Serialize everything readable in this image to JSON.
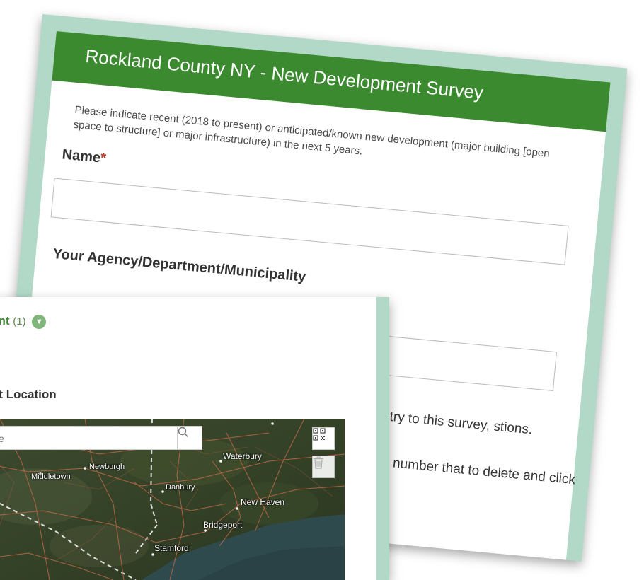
{
  "survey": {
    "title": "Rockland County NY - New Development Survey",
    "description": "Please indicate recent (2018 to present) or anticipated/known new development (major building [open space to structure] or major infrastructure) in the next 5 years.",
    "name_label": "Name",
    "required_mark": "*",
    "agency_label": "Your Agency/Department/Municipality",
    "para1": "entry to this survey, stions.",
    "para2": "the number that to delete and click"
  },
  "section": {
    "title_fragment": "ent",
    "count": "(1)",
    "location_label": "nt Location"
  },
  "map": {
    "search_placeholder": "ce",
    "cities": {
      "middletown": "Middletown",
      "newburgh": "Newburgh",
      "danbury": "Danbury",
      "waterbury": "Waterbury",
      "new_haven": "New Haven",
      "bridgeport": "Bridgeport",
      "stamford": "Stamford"
    }
  },
  "colors": {
    "header_green": "#3b8a2f",
    "card_border": "#b2d9c8",
    "required_red": "#c0392b"
  }
}
